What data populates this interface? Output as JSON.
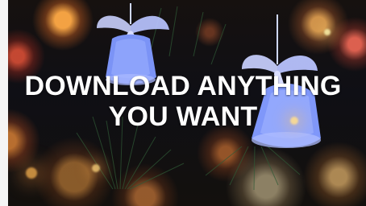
{
  "banner": {
    "title_line_1": "DOWNLOAD ANYTHING",
    "title_line_2": "YOU WANT",
    "text_color": "#ffffff",
    "bell_color": "#8fa8ff",
    "ribbon_color": "#d9ddff"
  }
}
